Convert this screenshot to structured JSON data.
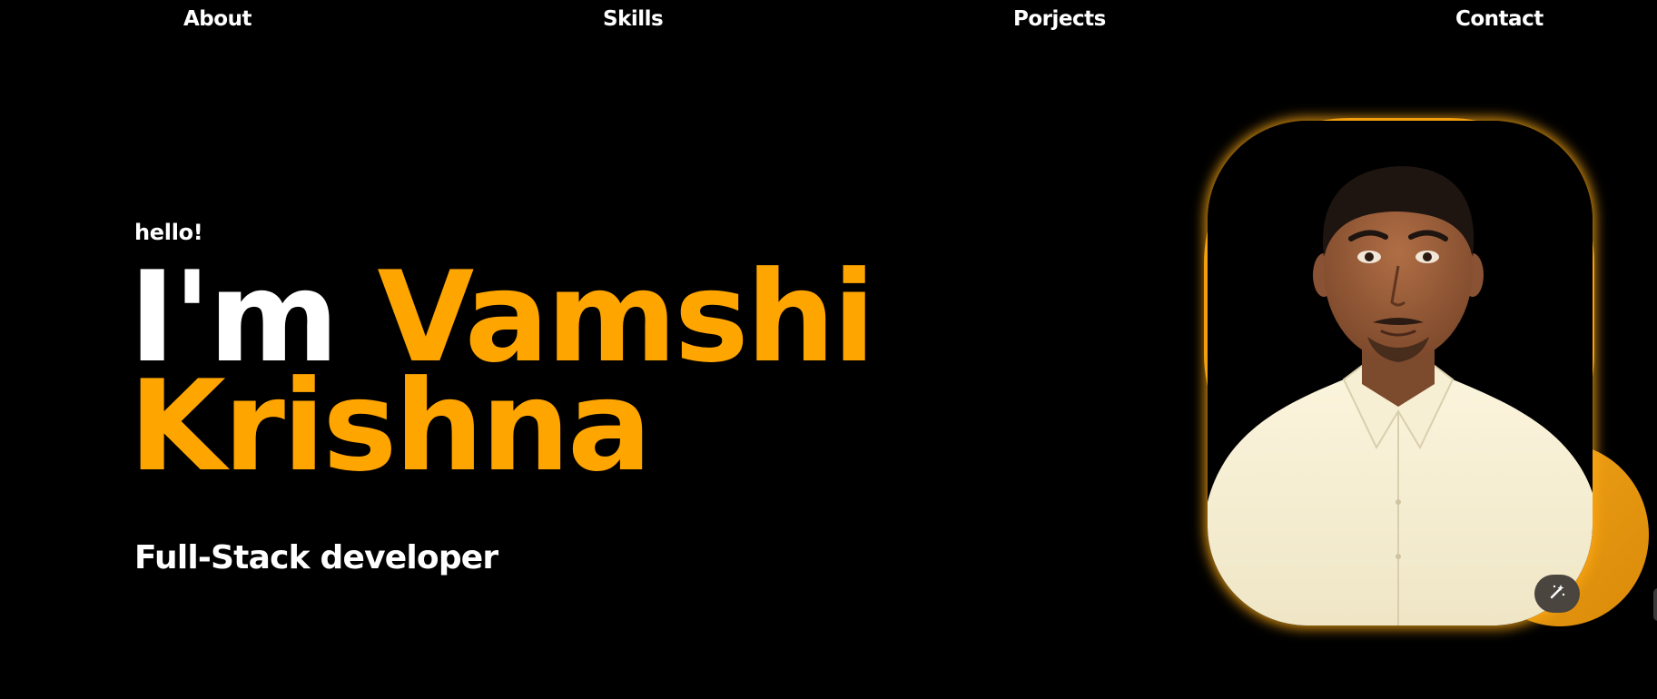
{
  "nav": {
    "items": [
      {
        "label": "About"
      },
      {
        "label": "Skills"
      },
      {
        "label": "Porjects"
      },
      {
        "label": "Contact"
      }
    ]
  },
  "hero": {
    "greeting": "hello!",
    "intro": "I'm",
    "first_name": "Vamshi",
    "last_name": "Krishna",
    "role": "Full-Stack developer"
  },
  "photo": {
    "icon": "magic-wand-icon"
  },
  "colors": {
    "accent": "#ffa500",
    "background": "#000000",
    "text": "#ffffff"
  }
}
